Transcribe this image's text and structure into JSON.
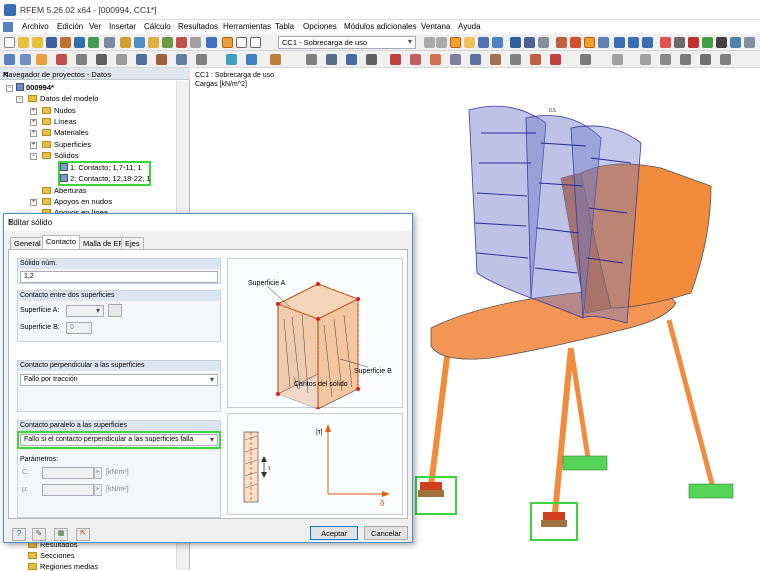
{
  "window": {
    "title": "RFEM 5.26.02 x64 - [000994, CC1*]"
  },
  "menu": [
    "Archivo",
    "Edición",
    "Ver",
    "Insertar",
    "Cálculo",
    "Resultados",
    "Herramientas",
    "Tabla",
    "Opciones",
    "Módulos adicionales",
    "Ventana",
    "Ayuda"
  ],
  "toolbar": {
    "loadcase": "CC1 - Sobrecarga de uso"
  },
  "navigator": {
    "title": "Navegador de proyectos - Datos",
    "project": "000994*",
    "model": "Datos del modelo",
    "items": [
      "Nudos",
      "Líneas",
      "Materiales",
      "Superficies",
      "Sólidos"
    ],
    "solids": [
      "1: Contacto; 1,7-11; 1",
      "2: Contacto; 12,18-22; 1"
    ],
    "items_after": [
      "Aberturas",
      "Apoyos en nudos",
      "Apoyos en línea"
    ],
    "bottom": [
      "Resultados",
      "Secciones",
      "Regiones medias"
    ]
  },
  "view": {
    "line1": "CC1 : Sobrecarga de uso",
    "line2": "Cargas [kN/m^2]",
    "load_label": "0.5"
  },
  "dialog": {
    "title": "Editar sólido",
    "tabs": [
      "General",
      "Contacto",
      "Malla de EF",
      "Ejes"
    ],
    "solid_no_label": "Sólido núm.",
    "solid_no": "1,2",
    "contact_between": "Contacto entre dos superficies",
    "surfA_label": "Superficie A:",
    "surfB_label": "Superficie B:",
    "surfB_value": "0",
    "perp_title": "Contacto perpendicular a las superficies",
    "perp_value": "Fallo por tracción",
    "par_title": "Contacto paralelo a las superficies",
    "par_value": "Fallo si el contacto perpendicular a las superficies falla",
    "params_label": "Parámetros:",
    "c_label": "C:",
    "c_unit": "[kN/m³]",
    "mu_label": "μ:",
    "mu_unit": "[kN/m²]",
    "fig_surfA": "Superficie A",
    "fig_surfB": "Superficie B",
    "fig_edges": "Cantos del sólido",
    "fig_tau": "|τ|",
    "fig_delta": "δ",
    "fig_tau_small": "τ",
    "ok": "Aceptar",
    "cancel": "Cancelar"
  },
  "colors": {
    "accent_green": "#3cd63c",
    "chair": "#f08c3c",
    "load": "#6e78c8"
  }
}
